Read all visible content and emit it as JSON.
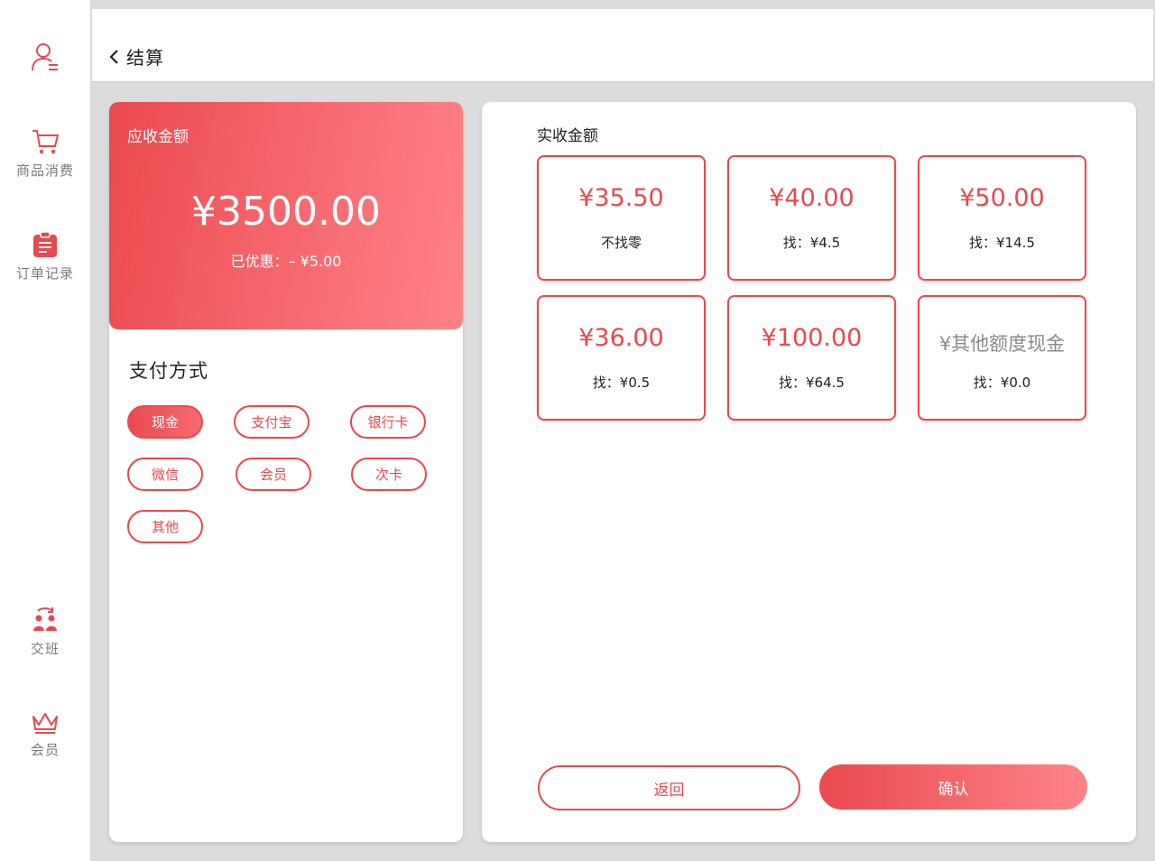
{
  "sidebar": {
    "items": [
      {
        "label": "",
        "icon": "user-icon"
      },
      {
        "label": "商品消费",
        "icon": "cart-icon"
      },
      {
        "label": "订单记录",
        "icon": "clipboard-icon"
      },
      {
        "label": "交班",
        "icon": "shift-handover-icon"
      },
      {
        "label": "会员",
        "icon": "crown-icon"
      }
    ]
  },
  "header": {
    "title": "结算",
    "back_icon": "chevron-left-icon"
  },
  "due": {
    "label": "应收金额",
    "amount": "¥3500.00",
    "discount": "已优惠：– ¥5.00"
  },
  "payment": {
    "title": "支付方式",
    "methods": [
      "现金",
      "支付宝",
      "银行卡",
      "微信",
      "会员",
      "次卡",
      "其他"
    ],
    "selected": "现金"
  },
  "received": {
    "title": "实收金额",
    "options": [
      {
        "amount": "¥35.50",
        "change": "不找零"
      },
      {
        "amount": "¥40.00",
        "change": "找：¥4.5"
      },
      {
        "amount": "¥50.00",
        "change": "找：¥14.5"
      },
      {
        "amount": "¥36.00",
        "change": "找：¥0.5"
      },
      {
        "amount": "¥100.00",
        "change": "找：¥64.5"
      },
      {
        "amount": "¥其他额度现金",
        "change": "找：¥0.0"
      }
    ]
  },
  "actions": {
    "back_label": "返回",
    "confirm_label": "确认"
  },
  "colors": {
    "accent": "#e64950",
    "gradient_start": "#ea4a4f",
    "gradient_end": "#ff8288"
  }
}
